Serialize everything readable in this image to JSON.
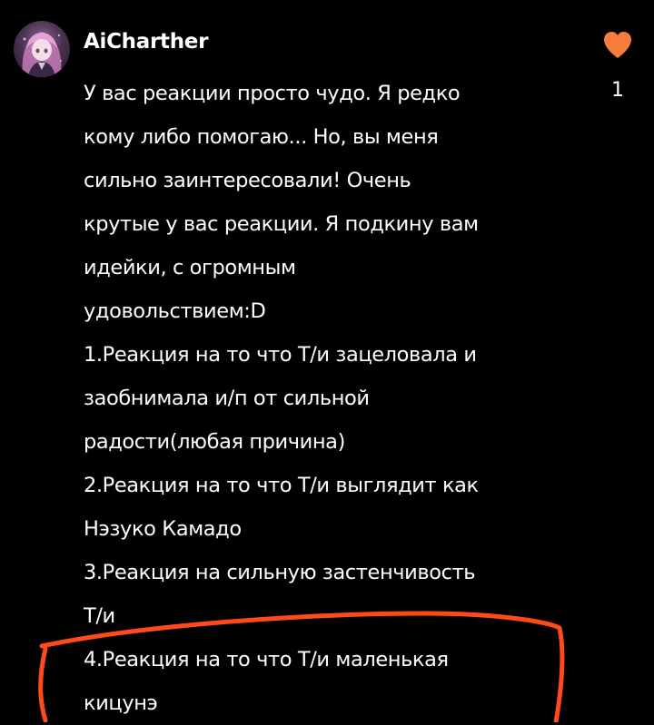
{
  "comment": {
    "username": "AiCharther",
    "avatar": "anime-girl-avatar",
    "lines": [
      "У вас реакции просто чудо. Я редко",
      "кому либо помогаю... Но, вы меня",
      "сильно заинтересовали! Очень",
      "крутые у вас реакции. Я подкину вам",
      "идейки, с огромным",
      "удовольствием:D",
      "1.Реакция на то что Т/и зацеловала и",
      "заобнимала и/п от сильной",
      "радости(любая причина)",
      "2.Реакция на то что Т/и выглядит как",
      "Нэзуко Камадо",
      "3.Реакция на сильную застенчивость",
      "Т/и",
      "4.Реакция на то что Т/и маленькая",
      "кицунэ"
    ],
    "like": {
      "icon": "heart-icon",
      "count": "1"
    }
  },
  "colors": {
    "background": "#000000",
    "text": "#ffffff",
    "heart": "#f47c3c",
    "highlight_marker": "#ff4a1c"
  }
}
